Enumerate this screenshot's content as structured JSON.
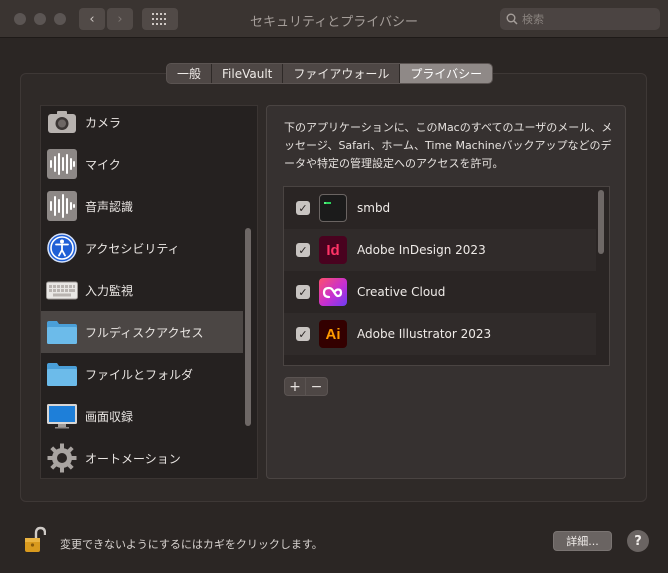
{
  "window": {
    "title": "セキュリティとプライバシー",
    "search_placeholder": "検索",
    "back_glyph": "‹",
    "forward_glyph": "›"
  },
  "tabs": [
    {
      "label": "一般",
      "active": false
    },
    {
      "label": "FileVault",
      "active": false
    },
    {
      "label": "ファイアウォール",
      "active": false
    },
    {
      "label": "プライバシー",
      "active": true
    }
  ],
  "categories": [
    {
      "label": "カメラ",
      "icon": "camera-icon"
    },
    {
      "label": "マイク",
      "icon": "microphone-icon"
    },
    {
      "label": "音声認識",
      "icon": "speech-recognition-icon"
    },
    {
      "label": "アクセシビリティ",
      "icon": "accessibility-icon"
    },
    {
      "label": "入力監視",
      "icon": "keyboard-icon"
    },
    {
      "label": "フルディスクアクセス",
      "icon": "folder-icon",
      "selected": true
    },
    {
      "label": "ファイルとフォルダ",
      "icon": "folder-icon"
    },
    {
      "label": "画面収録",
      "icon": "display-icon"
    },
    {
      "label": "オートメーション",
      "icon": "gear-icon"
    }
  ],
  "description": "下のアプリケーションに、このMacのすべてのユーザのメール、メッセージ、Safari、ホーム、Time Machineバックアップなどのデータや特定の管理設定へのアクセスを許可。",
  "apps": [
    {
      "name": "smbd",
      "checked": true,
      "icon": "terminal-icon",
      "icon_text": "",
      "color": "#1b1b1b"
    },
    {
      "name": "Adobe InDesign 2023",
      "checked": true,
      "icon": "indesign-icon",
      "icon_text": "Id",
      "color": "#ff3366"
    },
    {
      "name": "Creative Cloud",
      "checked": true,
      "icon": "creative-cloud-icon",
      "icon_text": "",
      "color": "#da1f26"
    },
    {
      "name": "Adobe Illustrator 2023",
      "checked": true,
      "icon": "illustrator-icon",
      "icon_text": "Ai",
      "color": "#ff9a00"
    }
  ],
  "buttons": {
    "add": "+",
    "remove": "−",
    "details": "詳細...",
    "help": "?"
  },
  "footer": {
    "lock_text": "変更できないようにするにはカギをクリックします。"
  }
}
